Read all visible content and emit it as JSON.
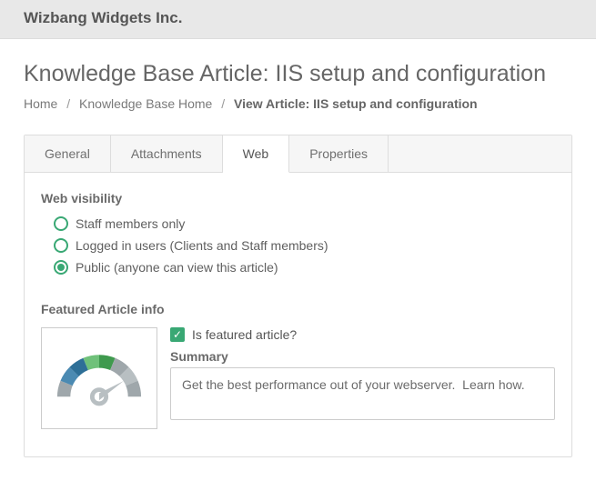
{
  "company": "Wizbang Widgets Inc.",
  "page_title": "Knowledge Base Article: IIS setup and configuration",
  "breadcrumb": {
    "home": "Home",
    "kb_home": "Knowledge Base Home",
    "current": "View Article: IIS setup and configuration"
  },
  "tabs": {
    "general": "General",
    "attachments": "Attachments",
    "web": "Web",
    "properties": "Properties"
  },
  "web": {
    "visibility_title": "Web visibility",
    "options": {
      "staff": "Staff members only",
      "logged_in": "Logged in users (Clients and Staff members)",
      "public": "Public (anyone can view this article)"
    },
    "selected": "public",
    "featured_title": "Featured Article info",
    "is_featured_label": "Is featured article?",
    "is_featured": true,
    "summary_label": "Summary",
    "summary_value": "Get the best performance out of your webserver.  Learn how."
  }
}
